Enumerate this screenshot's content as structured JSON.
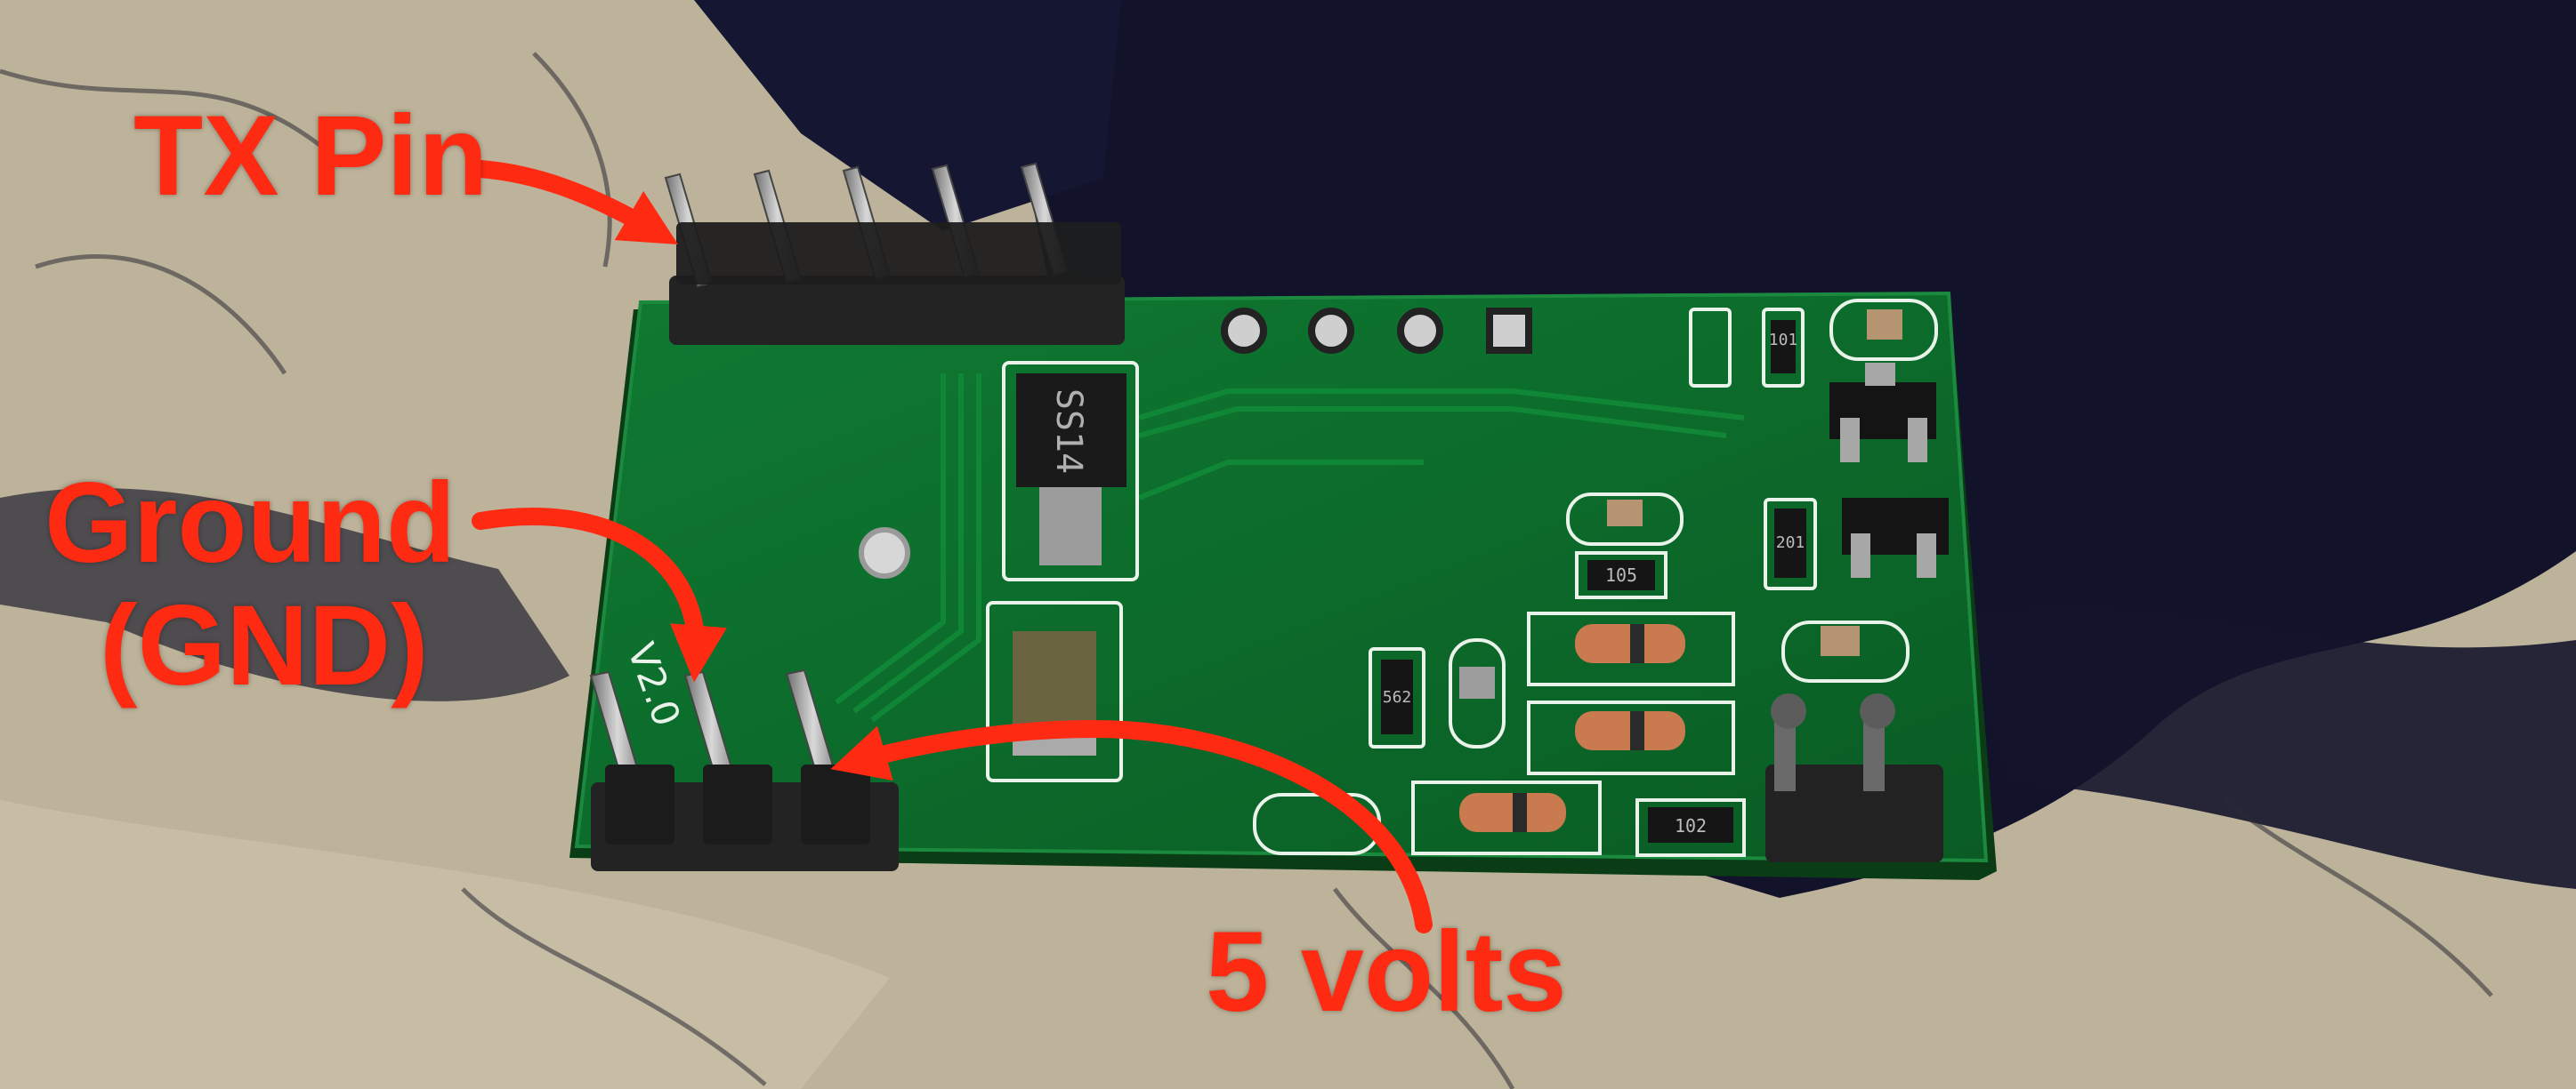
{
  "labels": {
    "tx_pin": "TX Pin",
    "ground_line1": "Ground",
    "ground_line2": "(GND)",
    "five_volts": "5 volts"
  },
  "board_silkscreen": {
    "diode_marking": "SS14",
    "version": "V2.0",
    "resistor_1": "101",
    "resistor_2": "201",
    "resistor_3": "105",
    "resistor_4": "562",
    "resistor_5": "102"
  },
  "colors": {
    "annotation_red": "#ff2a12",
    "pcb_green": "#0d6a2a",
    "fabric_beige": "#b8ae95",
    "background_dark": "#0f1020"
  }
}
